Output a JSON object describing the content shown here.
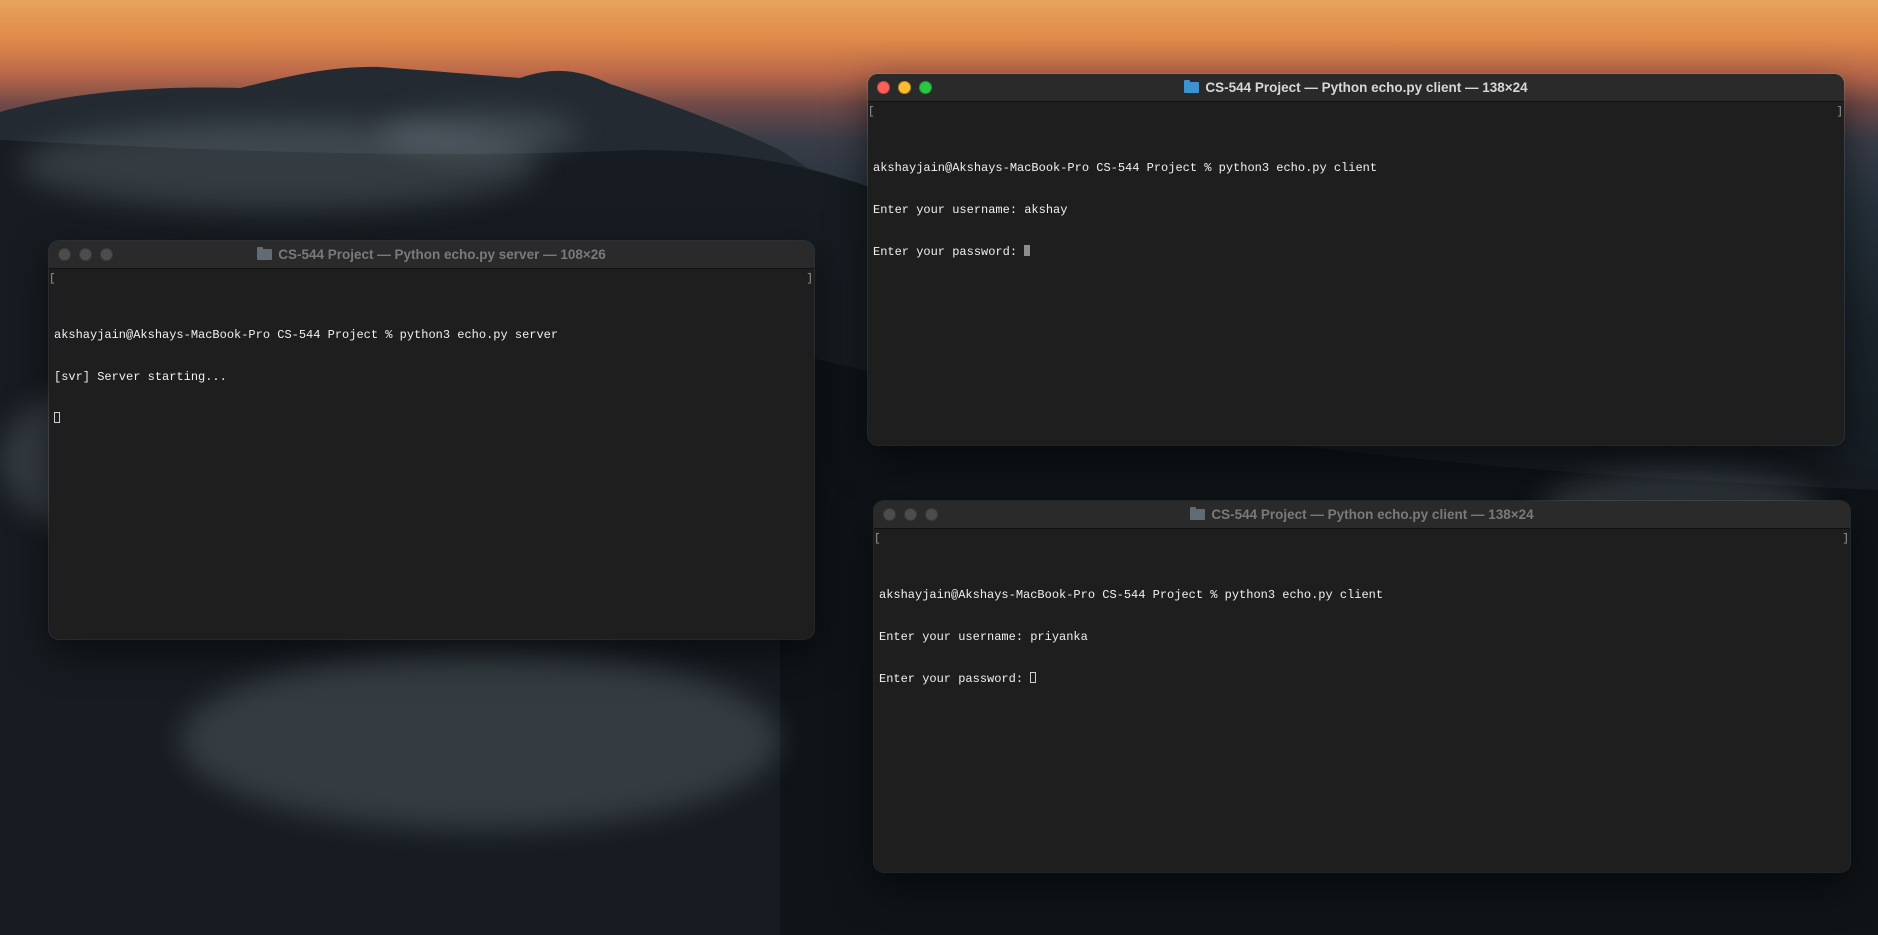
{
  "desktop": {
    "wallpaper": "sunset-over-clouds-mountain",
    "colors": {
      "sky_glow": "#e0894a",
      "terminal_bg": "#1e1e1e",
      "close": "#fe5f57",
      "minimize": "#febc2e",
      "maximize": "#28c840"
    }
  },
  "windows": {
    "server": {
      "title": "CS-544 Project — Python echo.py server — 108×26",
      "lines": [
        "akshayjain@Akshays-MacBook-Pro CS-544 Project % python3 echo.py server",
        "[svr] Server starting..."
      ],
      "active": false
    },
    "client1": {
      "title": "CS-544 Project — Python echo.py client — 138×24",
      "lines": [
        "akshayjain@Akshays-MacBook-Pro CS-544 Project % python3 echo.py client",
        "Enter your username: akshay",
        "Enter your password: "
      ],
      "active": true
    },
    "client2": {
      "title": "CS-544 Project — Python echo.py client — 138×24",
      "lines": [
        "akshayjain@Akshays-MacBook-Pro CS-544 Project % python3 echo.py client",
        "Enter your username: priyanka",
        "Enter your password: "
      ],
      "active": false
    }
  }
}
